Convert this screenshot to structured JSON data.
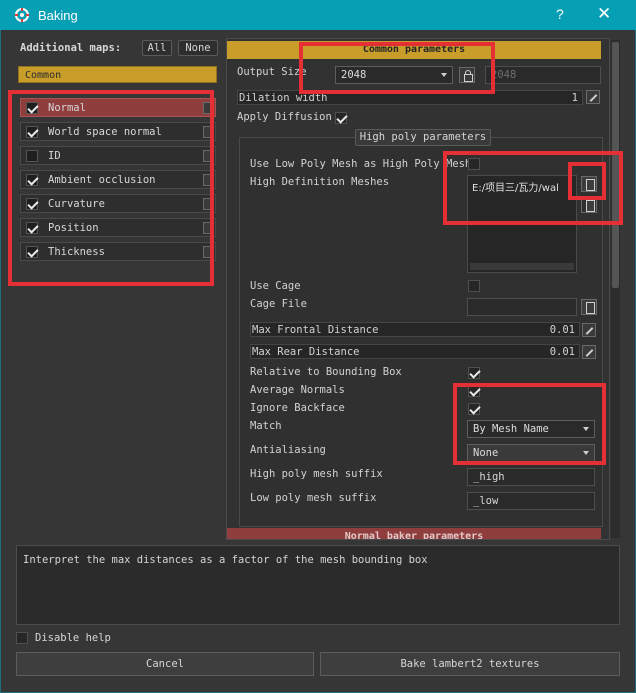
{
  "window": {
    "title": "Baking",
    "help_symbol": "?",
    "close_symbol": "✕"
  },
  "left": {
    "additional_maps_label": "Additional maps:",
    "all_label": "All",
    "none_label": "None",
    "common_tab": "Common",
    "maps": [
      {
        "label": "Normal",
        "checked": true,
        "selected": true
      },
      {
        "label": "World space normal",
        "checked": true,
        "selected": false
      },
      {
        "label": "ID",
        "checked": false,
        "selected": false
      },
      {
        "label": "Ambient occlusion",
        "checked": true,
        "selected": false
      },
      {
        "label": "Curvature",
        "checked": true,
        "selected": false
      },
      {
        "label": "Position",
        "checked": true,
        "selected": false
      },
      {
        "label": "Thickness",
        "checked": true,
        "selected": false
      }
    ]
  },
  "common": {
    "header": "Common parameters",
    "output_size_label": "Output Size",
    "output_size_value": "2048",
    "output_size_value2": "2048",
    "dilation_label": "Dilation width",
    "dilation_value": "1",
    "apply_diffusion_label": "Apply Diffusion",
    "apply_diffusion": true
  },
  "highpoly": {
    "header": "High poly parameters",
    "use_low_poly_label": "Use Low Poly Mesh as High Poly Mesh",
    "use_low_poly": false,
    "hd_meshes_label": "High Definition Meshes",
    "hd_meshes_value": "E:/项目三/瓦力/wal",
    "use_cage_label": "Use Cage",
    "use_cage": false,
    "cage_file_label": "Cage File",
    "cage_file_value": "",
    "max_frontal_label": "Max Frontal Distance",
    "max_frontal_value": "0.01",
    "max_rear_label": "Max Rear Distance",
    "max_rear_value": "0.01",
    "relative_bbox_label": "Relative to Bounding Box",
    "relative_bbox": true,
    "avg_normals_label": "Average Normals",
    "avg_normals": true,
    "ignore_backface_label": "Ignore Backface",
    "ignore_backface": true,
    "match_label": "Match",
    "match_value": "By Mesh Name",
    "antialiasing_label": "Antialiasing",
    "antialiasing_value": "None",
    "hp_suffix_label": "High poly mesh suffix",
    "hp_suffix_value": "_high",
    "lp_suffix_label": "Low poly mesh suffix",
    "lp_suffix_value": "_low"
  },
  "normal_section": {
    "header": "Normal baker parameters"
  },
  "help": {
    "text": "Interpret the max distances as a factor of the mesh bounding box",
    "disable_help_label": "Disable help",
    "disable_help": false
  },
  "footer": {
    "cancel_label": "Cancel",
    "bake_label": "Bake lambert2 textures"
  },
  "colors": {
    "titlebar": "#069fb4",
    "accent_orange": "#c89d2a",
    "selected_red": "#8f3d3d",
    "highlight_red": "#e62f35"
  }
}
